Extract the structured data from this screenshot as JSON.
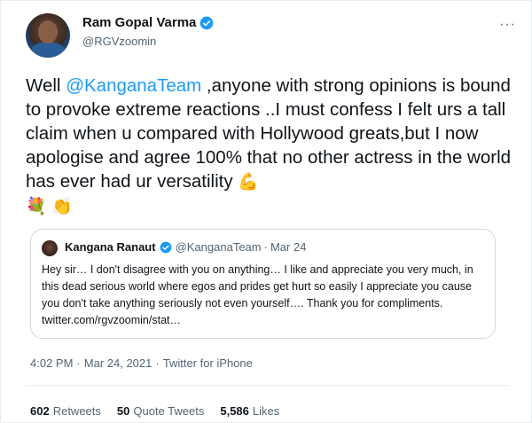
{
  "author": {
    "name": "Ram Gopal Varma",
    "handle": "@RGVzoomin"
  },
  "more_icon": "more-horizontal-icon",
  "tweet": {
    "text_before": "Well ",
    "mention": "@KanganaTeam",
    "text_after": " ,anyone with strong opinions is bound to provoke extreme reactions ..I must confess I felt urs a tall claim when u compared with Hollywood greats,but I now apologise and agree 100% that no other actress in the world has ever had ur versatility",
    "emoji_1": "💪",
    "emoji_2": "💐",
    "emoji_3": "👏"
  },
  "quoted": {
    "name": "Kangana Ranaut",
    "handle": "@KanganaTeam",
    "separator": "·",
    "date": "Mar 24",
    "text": "Hey sir… I don't disagree with you on anything… I like and appreciate you very much, in this dead serious world where egos and prides get hurt so easily I appreciate you cause you don't take anything seriously not even yourself…. Thank you for compliments. ",
    "link": "twitter.com/rgvzoomin/stat…"
  },
  "meta": {
    "time": "4:02 PM",
    "date": "Mar 24, 2021",
    "source": "Twitter for iPhone",
    "separator": "·"
  },
  "stats": {
    "retweets_count": "602",
    "retweets_label": "Retweets",
    "quotes_count": "50",
    "quotes_label": "Quote Tweets",
    "likes_count": "5,586",
    "likes_label": "Likes"
  },
  "colors": {
    "link": "#1d9bf0",
    "secondary": "#536471",
    "border": "#cfd9de",
    "verified": "#1d9bf0"
  }
}
